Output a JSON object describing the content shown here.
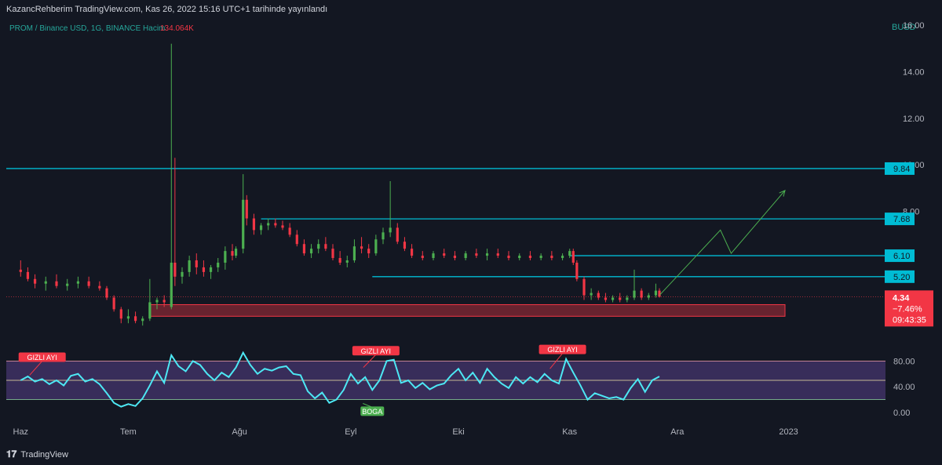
{
  "header": {
    "publish_note": "KazancRehberim TradingView.com, Kas 26, 2022 15:16 UTC+1 tarihinde yayınlandı"
  },
  "footer": {
    "brand": "TradingView",
    "logo_icon": "tradingview-logo-icon"
  },
  "chart_data": [
    {
      "type": "candlestick",
      "legend": {
        "symbol": "PROM / Binance USD, 1G, BINANCE",
        "volume_label": "Hacim",
        "volume_value": "134.064K"
      },
      "currency": "BUSD",
      "ylim": [
        2.4,
        16.2
      ],
      "yticks": [
        "16.00",
        "14.00",
        "12.00",
        "10.00",
        "8.00"
      ],
      "xticks": [
        "Haz",
        "Tem",
        "Ağu",
        "Eyl",
        "Eki",
        "Kas",
        "Ara",
        "2023"
      ],
      "x_range": [
        "2022-06-01",
        "2023-01-15"
      ],
      "ohlc": [
        [
          "2022-06-01",
          5.5,
          5.9,
          5.2,
          5.4
        ],
        [
          "2022-06-03",
          5.4,
          5.6,
          5.0,
          5.1
        ],
        [
          "2022-06-05",
          5.1,
          5.3,
          4.7,
          4.9
        ],
        [
          "2022-06-08",
          4.9,
          5.2,
          4.6,
          5.0
        ],
        [
          "2022-06-11",
          5.0,
          5.3,
          4.7,
          4.8
        ],
        [
          "2022-06-14",
          4.8,
          5.1,
          4.6,
          4.9
        ],
        [
          "2022-06-17",
          4.9,
          5.2,
          4.7,
          5.0
        ],
        [
          "2022-06-20",
          5.0,
          5.2,
          4.7,
          4.8
        ],
        [
          "2022-06-23",
          4.8,
          5.0,
          4.6,
          4.7
        ],
        [
          "2022-06-25",
          4.7,
          4.8,
          4.2,
          4.3
        ],
        [
          "2022-06-27",
          4.3,
          4.4,
          3.7,
          3.8
        ],
        [
          "2022-06-29",
          3.8,
          3.9,
          3.2,
          3.4
        ],
        [
          "2022-07-01",
          3.4,
          3.8,
          3.2,
          3.5
        ],
        [
          "2022-07-03",
          3.5,
          3.7,
          3.2,
          3.3
        ],
        [
          "2022-07-05",
          3.3,
          3.5,
          3.1,
          3.4
        ],
        [
          "2022-07-07",
          3.4,
          5.1,
          3.3,
          4.1
        ],
        [
          "2022-07-09",
          4.1,
          4.3,
          3.8,
          4.2
        ],
        [
          "2022-07-11",
          4.2,
          4.4,
          3.9,
          4.1
        ],
        [
          "2022-07-13",
          3.9,
          15.2,
          3.8,
          5.8
        ],
        [
          "2022-07-14",
          5.8,
          10.3,
          4.8,
          5.2
        ],
        [
          "2022-07-16",
          5.2,
          5.6,
          4.9,
          5.4
        ],
        [
          "2022-07-18",
          5.4,
          6.1,
          5.2,
          5.9
        ],
        [
          "2022-07-20",
          5.9,
          6.2,
          5.3,
          5.6
        ],
        [
          "2022-07-22",
          5.6,
          5.9,
          5.2,
          5.4
        ],
        [
          "2022-07-24",
          5.4,
          5.7,
          5.1,
          5.6
        ],
        [
          "2022-07-26",
          5.6,
          6.0,
          5.4,
          5.8
        ],
        [
          "2022-07-28",
          5.8,
          6.5,
          5.5,
          6.3
        ],
        [
          "2022-07-30",
          6.3,
          6.6,
          5.9,
          6.1
        ],
        [
          "2022-07-31",
          6.1,
          6.5,
          6.0,
          6.4
        ],
        [
          "2022-08-02",
          6.4,
          9.6,
          6.2,
          8.5
        ],
        [
          "2022-08-03",
          8.5,
          8.7,
          7.4,
          7.7
        ],
        [
          "2022-08-05",
          7.7,
          7.9,
          7.0,
          7.2
        ],
        [
          "2022-08-07",
          7.2,
          7.5,
          7.0,
          7.4
        ],
        [
          "2022-08-09",
          7.4,
          7.7,
          7.2,
          7.5
        ],
        [
          "2022-08-11",
          7.5,
          7.7,
          7.3,
          7.4
        ],
        [
          "2022-08-13",
          7.4,
          7.6,
          7.2,
          7.3
        ],
        [
          "2022-08-15",
          7.3,
          7.5,
          6.9,
          7.0
        ],
        [
          "2022-08-17",
          7.0,
          7.2,
          6.5,
          6.6
        ],
        [
          "2022-08-19",
          6.6,
          6.8,
          6.1,
          6.2
        ],
        [
          "2022-08-21",
          6.2,
          6.6,
          6.0,
          6.4
        ],
        [
          "2022-08-23",
          6.4,
          6.8,
          6.2,
          6.6
        ],
        [
          "2022-08-25",
          6.6,
          6.9,
          6.3,
          6.4
        ],
        [
          "2022-08-27",
          6.4,
          6.6,
          5.9,
          6.0
        ],
        [
          "2022-08-29",
          6.0,
          6.3,
          5.7,
          5.8
        ],
        [
          "2022-08-31",
          5.8,
          6.1,
          5.6,
          5.9
        ],
        [
          "2022-09-02",
          5.9,
          6.8,
          5.8,
          6.5
        ],
        [
          "2022-09-04",
          6.5,
          6.9,
          6.2,
          6.4
        ],
        [
          "2022-09-06",
          6.4,
          6.6,
          6.0,
          6.2
        ],
        [
          "2022-09-08",
          6.2,
          7.0,
          6.1,
          6.8
        ],
        [
          "2022-09-10",
          6.8,
          7.3,
          6.6,
          7.1
        ],
        [
          "2022-09-12",
          7.1,
          9.3,
          6.9,
          7.3
        ],
        [
          "2022-09-14",
          7.3,
          7.5,
          6.6,
          6.7
        ],
        [
          "2022-09-16",
          6.7,
          6.9,
          6.3,
          6.4
        ],
        [
          "2022-09-18",
          6.4,
          6.6,
          6.0,
          6.1
        ],
        [
          "2022-09-21",
          6.1,
          6.3,
          5.9,
          6.0
        ],
        [
          "2022-09-24",
          6.0,
          6.3,
          5.9,
          6.2
        ],
        [
          "2022-09-27",
          6.2,
          6.4,
          6.0,
          6.1
        ],
        [
          "2022-09-30",
          6.1,
          6.3,
          5.9,
          6.0
        ],
        [
          "2022-10-03",
          6.0,
          6.3,
          5.9,
          6.2
        ],
        [
          "2022-10-06",
          6.2,
          6.4,
          6.0,
          6.1
        ],
        [
          "2022-10-09",
          6.1,
          6.4,
          5.9,
          6.2
        ],
        [
          "2022-10-12",
          6.2,
          6.4,
          6.0,
          6.1
        ],
        [
          "2022-10-15",
          6.1,
          6.3,
          5.9,
          6.0
        ],
        [
          "2022-10-18",
          6.0,
          6.2,
          5.9,
          6.1
        ],
        [
          "2022-10-21",
          6.1,
          6.3,
          5.9,
          6.0
        ],
        [
          "2022-10-24",
          6.0,
          6.2,
          5.9,
          6.1
        ],
        [
          "2022-10-27",
          6.1,
          6.3,
          5.9,
          6.0
        ],
        [
          "2022-10-30",
          6.0,
          6.2,
          5.9,
          6.1
        ],
        [
          "2022-11-01",
          6.1,
          6.4,
          6.0,
          6.3
        ],
        [
          "2022-11-02",
          6.3,
          6.4,
          5.7,
          5.8
        ],
        [
          "2022-11-03",
          5.8,
          5.9,
          5.0,
          5.1
        ],
        [
          "2022-11-05",
          5.1,
          5.2,
          4.2,
          4.4
        ],
        [
          "2022-11-07",
          4.4,
          4.7,
          4.2,
          4.5
        ],
        [
          "2022-11-09",
          4.5,
          4.6,
          4.2,
          4.3
        ],
        [
          "2022-11-11",
          4.3,
          4.5,
          4.1,
          4.2
        ],
        [
          "2022-11-13",
          4.2,
          4.4,
          4.1,
          4.3
        ],
        [
          "2022-11-15",
          4.3,
          4.5,
          4.1,
          4.2
        ],
        [
          "2022-11-17",
          4.2,
          4.4,
          4.1,
          4.3
        ],
        [
          "2022-11-19",
          4.3,
          5.5,
          4.2,
          4.6
        ],
        [
          "2022-11-21",
          4.6,
          4.7,
          4.2,
          4.3
        ],
        [
          "2022-11-23",
          4.3,
          4.5,
          4.2,
          4.4
        ],
        [
          "2022-11-25",
          4.4,
          4.9,
          4.3,
          4.6
        ],
        [
          "2022-11-26",
          4.6,
          4.7,
          4.3,
          4.34
        ]
      ],
      "price_labels": {
        "levels": [
          "9.84",
          "7.68",
          "6.10",
          "5.20"
        ],
        "last_price": "4.34",
        "last_change": "−7.46%",
        "countdown": "09:43:35"
      },
      "horizontal_levels": [
        {
          "value": 9.84,
          "from": "2022-05-28",
          "to": "2023-02-05",
          "color": "#00bcd4"
        },
        {
          "value": 7.68,
          "from": "2022-08-07",
          "to": "2023-02-05",
          "color": "#00bcd4"
        },
        {
          "value": 6.1,
          "from": "2022-11-01",
          "to": "2023-02-05",
          "color": "#00bcd4"
        },
        {
          "value": 5.2,
          "from": "2022-09-07",
          "to": "2023-02-05",
          "color": "#00bcd4"
        }
      ],
      "support_zone": {
        "from": "2022-07-07",
        "to": "2022-12-31",
        "low": 3.5,
        "high": 4.0
      },
      "projection_path": [
        [
          "2022-11-26",
          4.4
        ],
        [
          "2022-12-13",
          7.2
        ],
        [
          "2022-12-16",
          6.2
        ],
        [
          "2022-12-31",
          8.9
        ]
      ],
      "colors": {
        "up": "#4caf50",
        "down": "#f23645",
        "level": "#00bcd4",
        "last_price": "#f23645"
      }
    },
    {
      "type": "line",
      "ylim": [
        0,
        100
      ],
      "yticks": [
        "80.00",
        "40.00",
        "0.00"
      ],
      "bands": {
        "upper": 80,
        "middle": 50,
        "lower": 20
      },
      "x_range": [
        "2022-06-01",
        "2023-01-15"
      ],
      "series": [
        {
          "values": [
            [
              "2022-06-01",
              50
            ],
            [
              "2022-06-03",
              56
            ],
            [
              "2022-06-05",
              48
            ],
            [
              "2022-06-07",
              52
            ],
            [
              "2022-06-09",
              44
            ],
            [
              "2022-06-11",
              50
            ],
            [
              "2022-06-13",
              42
            ],
            [
              "2022-06-15",
              57
            ],
            [
              "2022-06-17",
              60
            ],
            [
              "2022-06-19",
              48
            ],
            [
              "2022-06-21",
              52
            ],
            [
              "2022-06-23",
              44
            ],
            [
              "2022-06-25",
              30
            ],
            [
              "2022-06-27",
              15
            ],
            [
              "2022-06-29",
              9
            ],
            [
              "2022-07-01",
              13
            ],
            [
              "2022-07-03",
              10
            ],
            [
              "2022-07-05",
              22
            ],
            [
              "2022-07-07",
              42
            ],
            [
              "2022-07-09",
              64
            ],
            [
              "2022-07-11",
              46
            ],
            [
              "2022-07-13",
              89
            ],
            [
              "2022-07-15",
              72
            ],
            [
              "2022-07-17",
              64
            ],
            [
              "2022-07-19",
              80
            ],
            [
              "2022-07-21",
              74
            ],
            [
              "2022-07-23",
              60
            ],
            [
              "2022-07-25",
              50
            ],
            [
              "2022-07-27",
              62
            ],
            [
              "2022-07-29",
              55
            ],
            [
              "2022-07-31",
              70
            ],
            [
              "2022-08-02",
              93
            ],
            [
              "2022-08-04",
              74
            ],
            [
              "2022-08-06",
              60
            ],
            [
              "2022-08-08",
              68
            ],
            [
              "2022-08-10",
              65
            ],
            [
              "2022-08-12",
              70
            ],
            [
              "2022-08-14",
              72
            ],
            [
              "2022-08-16",
              60
            ],
            [
              "2022-08-18",
              58
            ],
            [
              "2022-08-20",
              33
            ],
            [
              "2022-08-22",
              22
            ],
            [
              "2022-08-24",
              31
            ],
            [
              "2022-08-26",
              15
            ],
            [
              "2022-08-28",
              20
            ],
            [
              "2022-08-30",
              35
            ],
            [
              "2022-09-01",
              60
            ],
            [
              "2022-09-03",
              45
            ],
            [
              "2022-09-05",
              55
            ],
            [
              "2022-09-07",
              35
            ],
            [
              "2022-09-09",
              50
            ],
            [
              "2022-09-11",
              80
            ],
            [
              "2022-09-13",
              82
            ],
            [
              "2022-09-15",
              46
            ],
            [
              "2022-09-17",
              50
            ],
            [
              "2022-09-19",
              38
            ],
            [
              "2022-09-21",
              46
            ],
            [
              "2022-09-23",
              36
            ],
            [
              "2022-09-25",
              42
            ],
            [
              "2022-09-27",
              45
            ],
            [
              "2022-09-29",
              58
            ],
            [
              "2022-10-01",
              68
            ],
            [
              "2022-10-03",
              50
            ],
            [
              "2022-10-05",
              62
            ],
            [
              "2022-10-07",
              46
            ],
            [
              "2022-10-09",
              68
            ],
            [
              "2022-10-11",
              55
            ],
            [
              "2022-10-13",
              45
            ],
            [
              "2022-10-15",
              38
            ],
            [
              "2022-10-17",
              55
            ],
            [
              "2022-10-19",
              45
            ],
            [
              "2022-10-21",
              55
            ],
            [
              "2022-10-23",
              47
            ],
            [
              "2022-10-25",
              60
            ],
            [
              "2022-10-27",
              50
            ],
            [
              "2022-10-29",
              45
            ],
            [
              "2022-10-31",
              83
            ],
            [
              "2022-11-02",
              62
            ],
            [
              "2022-11-04",
              42
            ],
            [
              "2022-11-06",
              20
            ],
            [
              "2022-11-08",
              30
            ],
            [
              "2022-11-10",
              26
            ],
            [
              "2022-11-12",
              22
            ],
            [
              "2022-11-14",
              24
            ],
            [
              "2022-11-16",
              20
            ],
            [
              "2022-11-18",
              38
            ],
            [
              "2022-11-20",
              52
            ],
            [
              "2022-11-22",
              32
            ],
            [
              "2022-11-24",
              50
            ],
            [
              "2022-11-26",
              56
            ]
          ]
        }
      ],
      "annotations": [
        {
          "text": "GIZLI AYI",
          "kind": "bear",
          "at": "2022-06-07"
        },
        {
          "text": "GIZLI AYI",
          "kind": "bear",
          "at": "2022-09-08"
        },
        {
          "text": "GIZLI AYI",
          "kind": "bear",
          "at": "2022-10-30"
        },
        {
          "text": "BOGA",
          "kind": "bull",
          "at": "2022-09-07"
        }
      ],
      "colors": {
        "line": "#4de8f4",
        "band_fill": "#4a2a6b",
        "bear": "#f23645",
        "bull": "#4caf50"
      }
    }
  ]
}
